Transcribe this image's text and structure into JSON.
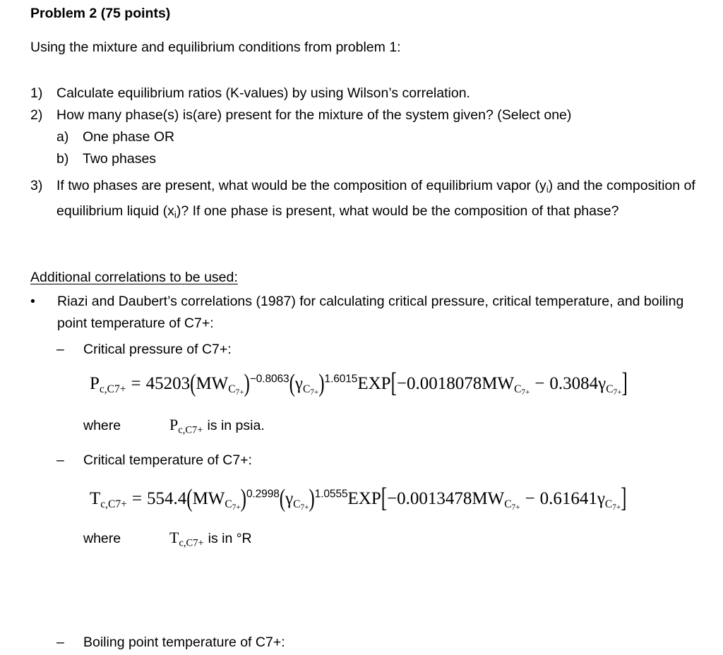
{
  "document": {
    "heading": "Problem 2 (75 points)",
    "intro": "Using the mixture and equilibrium conditions from problem 1:",
    "questions": [
      {
        "marker": "1)",
        "text": "Calculate equilibrium ratios (K-values) by using Wilson’s correlation."
      },
      {
        "marker": "2)",
        "text": "How many phase(s) is(are) present for the mixture of the system given? (Select one)"
      },
      {
        "marker": "a)",
        "text": "One phase OR"
      },
      {
        "marker": "b)",
        "text": "Two phases"
      },
      {
        "marker": "3)",
        "text_part1": "If two phases are present, what would be the composition of equilibrium vapor (y",
        "sub1": "i",
        "text_part2": ") and the composition of equilibrium liquid (x",
        "sub2": "i",
        "text_part3": ")? If one phase is present, what would be the composition of that phase?"
      }
    ],
    "section_heading": "Additional correlations to be used:",
    "bullet": {
      "marker": "•",
      "text": "Riazi and Daubert’s correlations (1987) for calculating critical pressure, critical temperature, and boiling point temperature of C7+:"
    },
    "subitems": [
      {
        "marker": "–",
        "text": "Critical pressure of C7+:"
      },
      {
        "marker": "–",
        "text": "Critical temperature of C7+:"
      },
      {
        "marker": "–",
        "text": "Boiling point temperature of C7+:"
      }
    ],
    "formula_pressure": {
      "lhs_var": "P",
      "lhs_sub": "c,C7+",
      "equals": "=",
      "coefficient": "45203",
      "open_paren": "(",
      "base1": "MW",
      "base1_sub": "C",
      "base1_sub_sub": "7+",
      "close_paren": ")",
      "exponent1": "−0.8063",
      "open_paren2": "(",
      "gamma": "γ",
      "gamma_sub": "C",
      "gamma_sub_sub": "7+",
      "close_paren2": ")",
      "exponent2": "1.6015",
      "exp_label": "EXP",
      "open_bracket": "[",
      "term1": "−0.0018078MW",
      "term1_sub": "C",
      "term1_sub_sub": "7+",
      "minus": "−",
      "term2": "0.3084",
      "term2_gamma": "γ",
      "term2_sub": "C",
      "term2_sub_sub": "7+",
      "close_bracket": "]"
    },
    "where_pressure": {
      "where": "where",
      "symbol_var": "P",
      "symbol_sub": "c,C7+",
      "rest": "is in psia."
    },
    "formula_temperature": {
      "lhs_var": "T",
      "lhs_sub": "c,C7+",
      "equals": "=",
      "coefficient": "554.4",
      "open_paren": "(",
      "base1": "MW",
      "base1_sub": "C",
      "base1_sub_sub": "7+",
      "close_paren": ")",
      "exponent1": "0.2998",
      "open_paren2": "(",
      "gamma": "γ",
      "gamma_sub": "C",
      "gamma_sub_sub": "7+",
      "close_paren2": ")",
      "exponent2": "1.0555",
      "exp_label": "EXP",
      "open_bracket": "[",
      "term1": "−0.0013478MW",
      "term1_sub": "C",
      "term1_sub_sub": "7+",
      "minus": "−",
      "term2": "0.61641",
      "term2_gamma": "γ",
      "term2_sub": "C",
      "term2_sub_sub": "7+",
      "close_bracket": "]"
    },
    "where_temperature": {
      "where": "where",
      "symbol_var": "T",
      "symbol_sub": "c,C7+",
      "rest": "is in °R"
    }
  },
  "colors": {
    "background": "#ffffff",
    "text": "#000000"
  }
}
